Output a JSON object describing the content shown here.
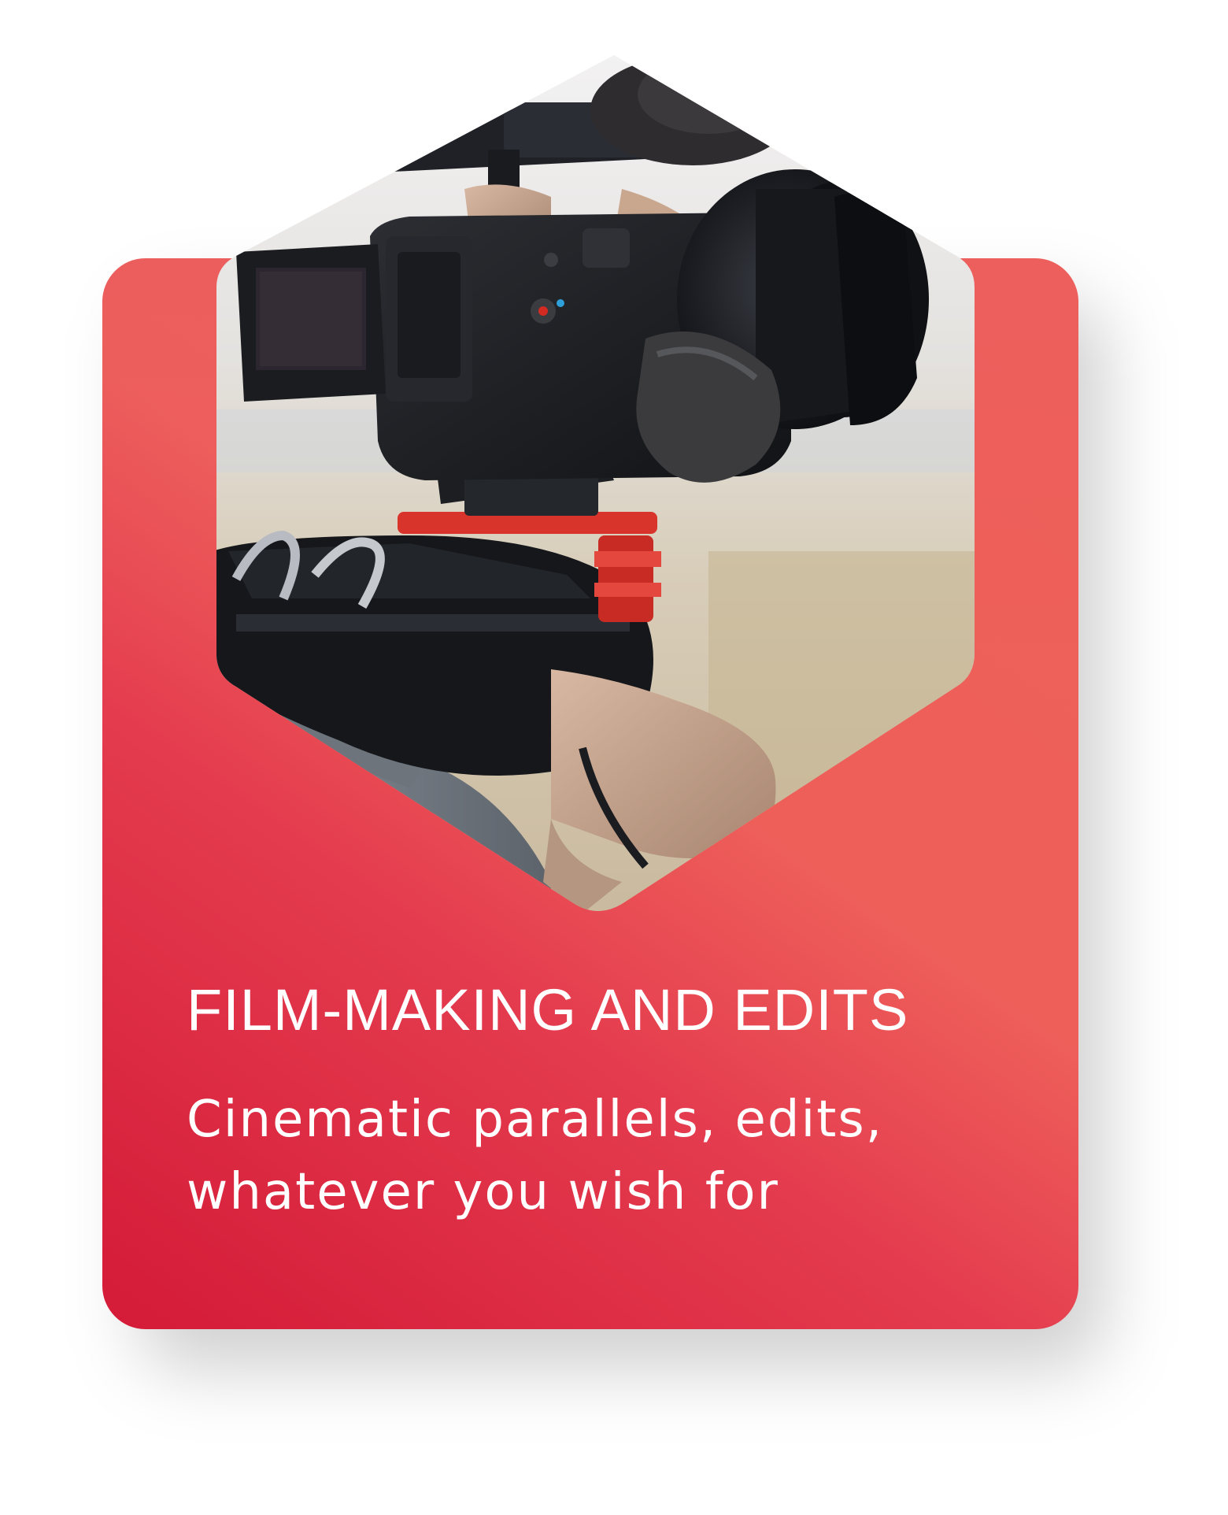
{
  "card": {
    "title": "FILM-MAKING AND EDITS",
    "description": "Cinematic parallels, edits, whatever you wish for",
    "image_icon": "video-camera-photo"
  },
  "colors": {
    "card_gradient_start": "#d41a37",
    "card_gradient_end": "#ef6059",
    "text": "#ffffff",
    "accent_red_mount": "#d9342b"
  }
}
